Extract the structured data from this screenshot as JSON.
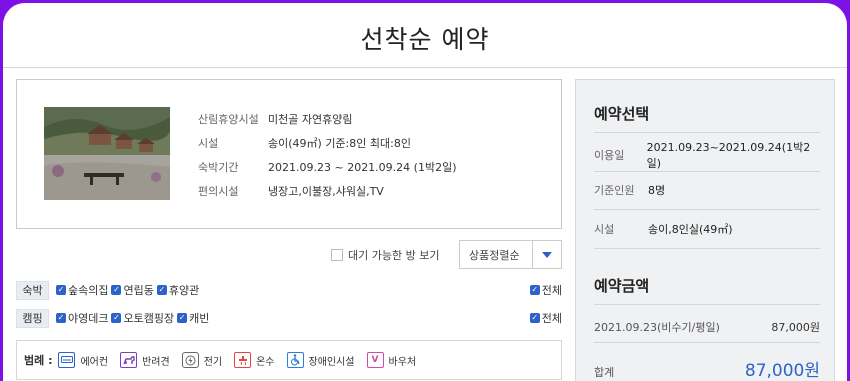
{
  "page": {
    "title": "선착순 예약"
  },
  "facility": {
    "rows": [
      {
        "label": "산림휴양시설",
        "value": "미천골 자연휴양림"
      },
      {
        "label": "시설",
        "value": "송이(49㎡) 기준:8인 최대:8인"
      },
      {
        "label": "숙박기간",
        "value": "2021.09.23 ~ 2021.09.24 (1박2일)"
      },
      {
        "label": "편의시설",
        "value": "냉장고,이불장,샤워실,TV"
      }
    ]
  },
  "sort": {
    "wait_label": "대기 가능한 방 보기",
    "select_value": "상품정렬순"
  },
  "filters": {
    "lodging": {
      "tag": "숙박",
      "options": [
        "숲속의집",
        "연립동",
        "휴양관"
      ],
      "all_label": "전체"
    },
    "camping": {
      "tag": "캠핑",
      "options": [
        "야영데크",
        "오토캠핑장",
        "캐빈"
      ],
      "all_label": "전체"
    }
  },
  "legend": {
    "title": "범례 :",
    "items": [
      {
        "icon": "air-conditioner-icon",
        "label": "에어컨",
        "color": "#2d63c8"
      },
      {
        "icon": "pet-icon",
        "label": "반려견",
        "color": "#7b3fc4"
      },
      {
        "icon": "electric-icon",
        "label": "전기",
        "color": "#666666"
      },
      {
        "icon": "hot-water-icon",
        "label": "온수",
        "color": "#e0454a"
      },
      {
        "icon": "accessible-icon",
        "label": "장애인시설",
        "color": "#2d7fd6"
      },
      {
        "icon": "voucher-icon",
        "label": "바우처",
        "color": "#d04bb0"
      }
    ]
  },
  "reservation": {
    "title": "예약선택",
    "rows": [
      {
        "label": "이용일",
        "value": "2021.09.23~2021.09.24(1박2일)"
      },
      {
        "label": "기준인원",
        "value": "8명"
      },
      {
        "label": "시설",
        "value": "송이,8인실(49㎡)"
      }
    ]
  },
  "payment": {
    "title": "예약금액",
    "line_label": "2021.09.23(비수기/평일)",
    "line_value": "87,000원",
    "total_label": "합계",
    "total_value": "87,000원"
  }
}
